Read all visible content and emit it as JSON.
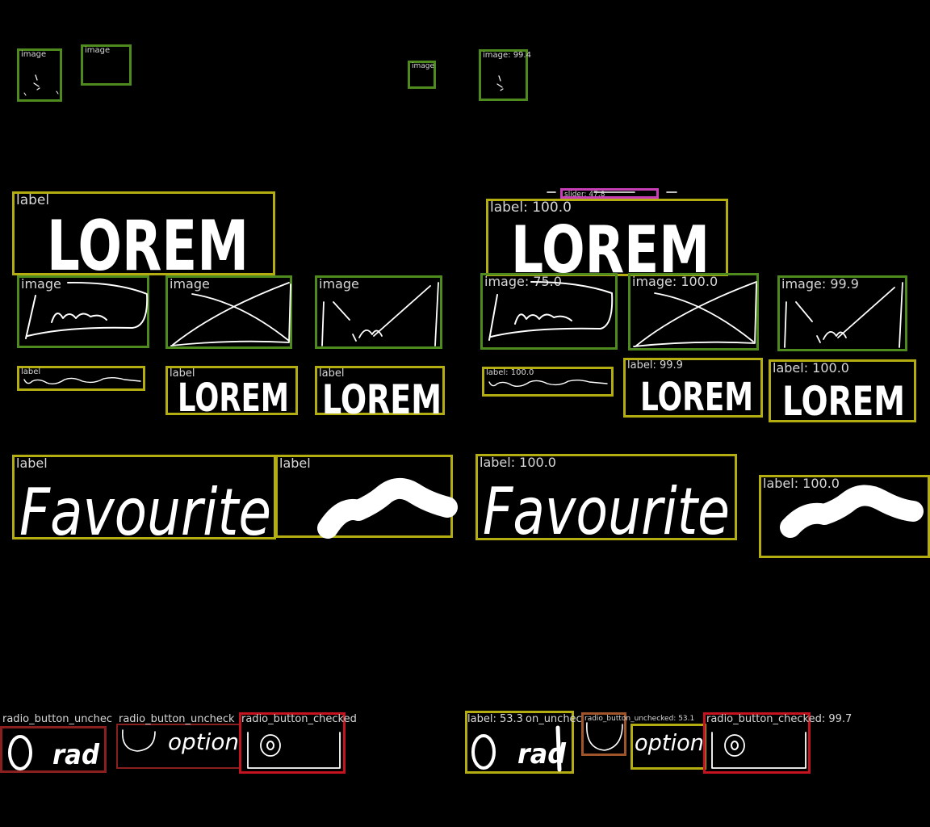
{
  "colors": {
    "background": "#000000",
    "image_box": "#4f8a1e",
    "label_box": "#b3ad12",
    "radio_checked_box": "#c4131e",
    "radio_unchecked_box": "#8a1f1f",
    "slider_box": "#c63fb5",
    "ink": "#ffffff",
    "caption_text": "#d7d7d7"
  },
  "left": {
    "image_1": "image",
    "image_2": "image",
    "image_3": "image",
    "label_lorem_big": "label",
    "image_squiggle": "image",
    "image_cross": "image",
    "image_sketch": "image",
    "label_wave": "label",
    "label_lorem_a": "label",
    "label_lorem_b": "label",
    "label_favourite": "label",
    "label_blob": "label",
    "radio_1": "radio_button_unchec",
    "radio_2": "radio_button_uncheck",
    "radio_3": "radio_button_checked"
  },
  "right": {
    "image_1": "image: 99.4",
    "slider": "slider: 47.8",
    "label_lorem_big": "label: 100.0",
    "image_squiggle": "image: 75.0",
    "image_cross": "image: 100.0",
    "image_sketch": "image: 99.9",
    "label_wave": "label: 100.0",
    "label_lorem_a": "label: 99.9",
    "label_lorem_b": "label: 100.0",
    "label_favourite": "label: 100.0",
    "label_blob": "label: 100.0",
    "label_rad": "label: 53.3",
    "radio_partial": "on_unchec",
    "radio_small": "radio_button_unchecked: 53.1",
    "radio_checked": "radio_button_checked: 99.7"
  },
  "drawn_text": {
    "lorem": "LOREM",
    "favourite": "Favourite",
    "rad": "rad",
    "option": "option"
  }
}
